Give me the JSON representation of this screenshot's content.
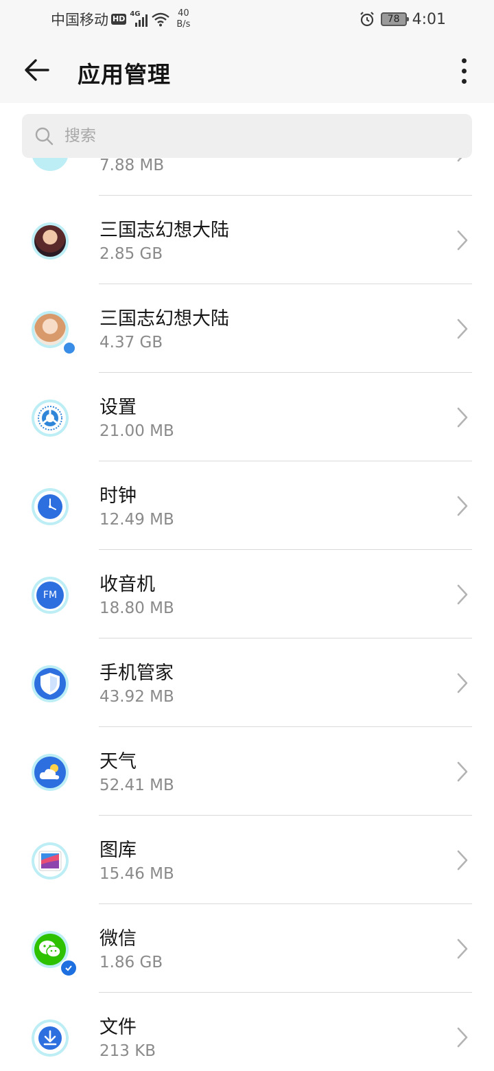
{
  "status_bar": {
    "carrier": "中国移动",
    "hd": "HD",
    "network": "4G",
    "speed_value": "40",
    "speed_unit": "B/s",
    "battery": "78",
    "time": "4:01"
  },
  "header": {
    "title": "应用管理"
  },
  "search": {
    "placeholder": "搜索"
  },
  "apps": [
    {
      "name": "",
      "size": "7.88 MB",
      "icon": "partial-app-icon"
    },
    {
      "name": "三国志幻想大陆",
      "size": "2.85 GB",
      "icon": "game-avatar-icon"
    },
    {
      "name": "三国志幻想大陆",
      "size": "4.37 GB",
      "icon": "game-avatar-clone-icon"
    },
    {
      "name": "设置",
      "size": "21.00 MB",
      "icon": "settings-icon"
    },
    {
      "name": "时钟",
      "size": "12.49 MB",
      "icon": "clock-icon"
    },
    {
      "name": "收音机",
      "size": "18.80 MB",
      "icon": "radio-fm-icon",
      "icon_text": "FM"
    },
    {
      "name": "手机管家",
      "size": "43.92 MB",
      "icon": "shield-icon"
    },
    {
      "name": "天气",
      "size": "52.41 MB",
      "icon": "weather-icon"
    },
    {
      "name": "图库",
      "size": "15.46 MB",
      "icon": "gallery-icon"
    },
    {
      "name": "微信",
      "size": "1.86 GB",
      "icon": "wechat-icon"
    },
    {
      "name": "文件",
      "size": "213 KB",
      "icon": "files-download-icon"
    }
  ],
  "colors": {
    "flower_outer": "#8fdcea",
    "flower_inner": "#bdeef5",
    "accent_blue": "#1e6fe0",
    "wechat_green": "#2dc100"
  }
}
